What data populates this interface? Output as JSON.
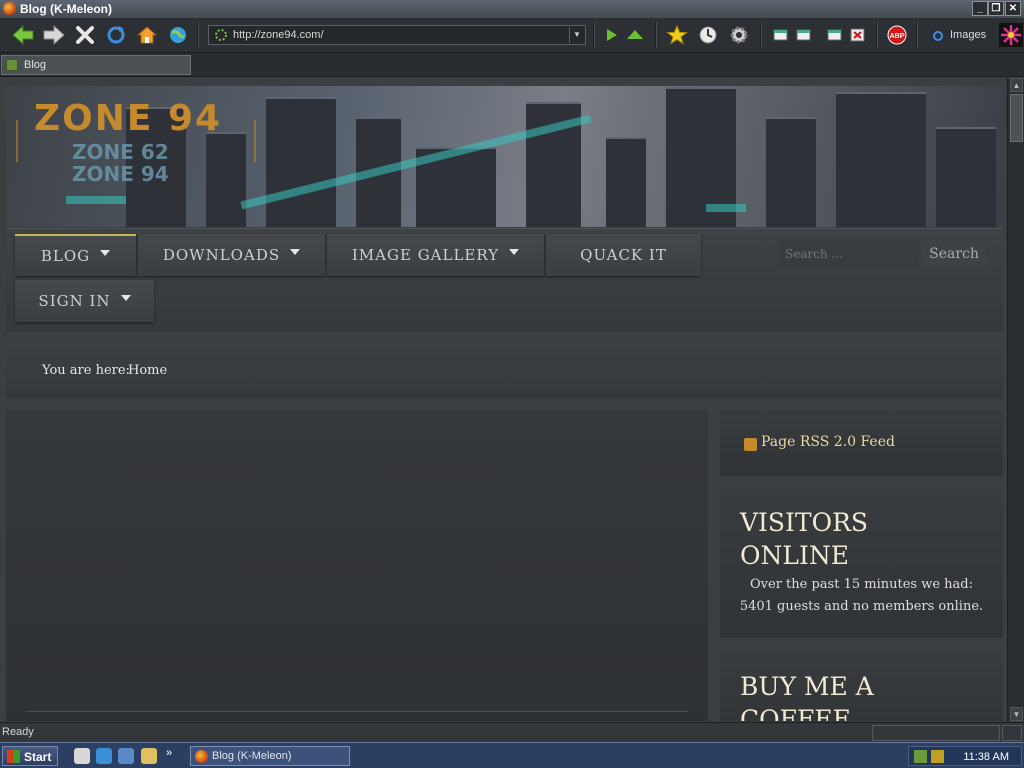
{
  "window": {
    "title": "Blog (K-Meleon)"
  },
  "toolbar": {
    "url": "http://zone94.com/",
    "images_label": "Images"
  },
  "tabs": [
    {
      "label": "Blog"
    }
  ],
  "site": {
    "logo_main": "ZONE 94",
    "logo_sub_1": "ZONE 62",
    "logo_sub_2": "ZONE 94"
  },
  "nav": {
    "items": [
      {
        "label": "BLOG",
        "has_caret": true,
        "active": true
      },
      {
        "label": "DOWNLOADS",
        "has_caret": true
      },
      {
        "label": "IMAGE GALLERY",
        "has_caret": true
      },
      {
        "label": "QUACK IT",
        "has_caret": false
      },
      {
        "label": "SIGN IN",
        "has_caret": true
      }
    ],
    "search_placeholder": "Search ...",
    "search_button": "Search"
  },
  "breadcrumb": {
    "label": "You are here:",
    "current": "Home"
  },
  "sidebar": {
    "rss_label": "Page RSS 2.0 Feed",
    "visitors_title_line1": "VISITORS",
    "visitors_title_line2": "ONLINE",
    "visitors_text_line1": "Over the past 15 minutes we had:",
    "visitors_text_line2": "5401 guests and no members online.",
    "coffee_title_line1": "BUY ME A",
    "coffee_title_line2": "COFFEE"
  },
  "status": {
    "text": "Ready"
  },
  "taskbar": {
    "start_label": "Start",
    "task_label": "Blog (K-Meleon)",
    "clock": "11:38 AM"
  },
  "colors": {
    "accent_gold": "#c9b65a",
    "logo_orange": "#c58a2e",
    "page_bg": "#3c3f42"
  }
}
